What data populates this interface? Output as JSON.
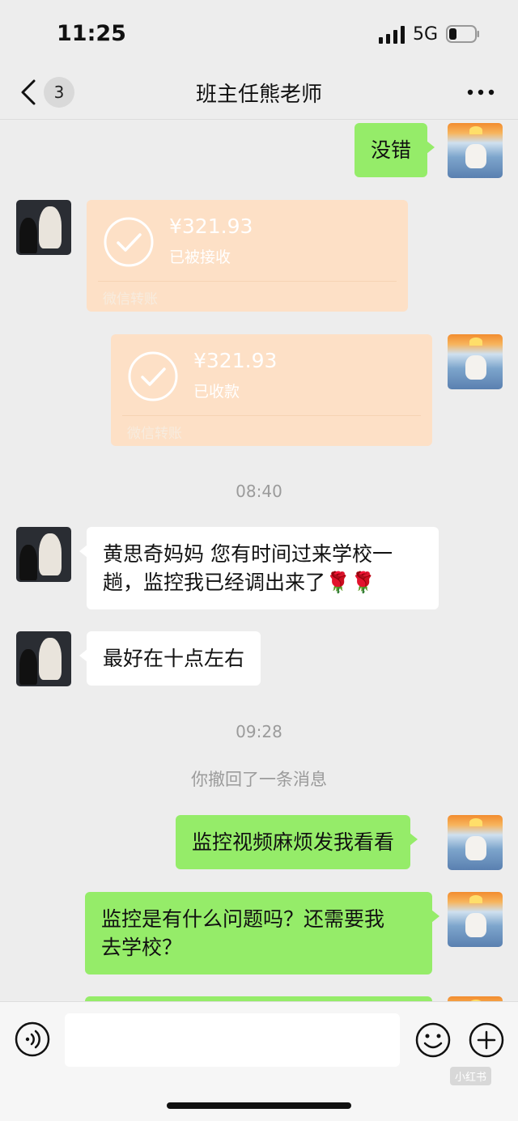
{
  "status_bar": {
    "time": "11:25",
    "network": "5G"
  },
  "header": {
    "unread_count": "3",
    "title": "班主任熊老师"
  },
  "messages": [
    {
      "type": "text",
      "text": "没错"
    },
    {
      "type": "transfer",
      "amount": "¥321.93",
      "status": "已被接收",
      "label": "微信转账"
    },
    {
      "type": "transfer",
      "amount": "¥321.93",
      "status": "已收款",
      "label": "微信转账"
    },
    {
      "type": "timestamp",
      "text": "08:40"
    },
    {
      "type": "text",
      "lines": [
        "黄思奇妈妈 您有时间过来学校一",
        "趟，监控我已经调出来了🌹🌹"
      ]
    },
    {
      "type": "text",
      "text": "最好在十点左右"
    },
    {
      "type": "timestamp",
      "text": "09:28"
    },
    {
      "type": "system",
      "text": "你撤回了一条消息"
    },
    {
      "type": "text",
      "text": "监控视频麻烦发我看看"
    },
    {
      "type": "text",
      "lines": [
        "监控是有什么问题吗？还需要我",
        "去学校？"
      ]
    }
  ],
  "input_bar": {
    "placeholder": "",
    "watermark": "小红书"
  },
  "colors": {
    "self_bubble": "#95ec69",
    "other_bubble": "#ffffff",
    "transfer": "#fde0c6",
    "background": "#ededed"
  }
}
